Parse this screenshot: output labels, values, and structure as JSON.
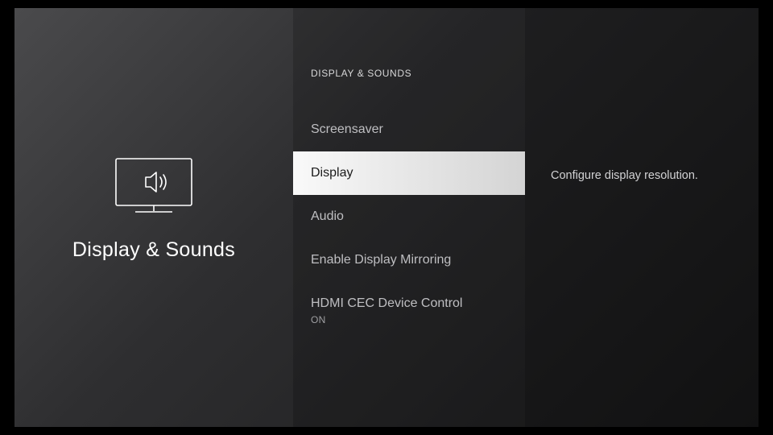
{
  "left": {
    "title": "Display & Sounds"
  },
  "middle": {
    "header": "DISPLAY & SOUNDS",
    "items": [
      {
        "label": "Screensaver",
        "sub": null,
        "selected": false
      },
      {
        "label": "Display",
        "sub": null,
        "selected": true
      },
      {
        "label": "Audio",
        "sub": null,
        "selected": false
      },
      {
        "label": "Enable Display Mirroring",
        "sub": null,
        "selected": false
      },
      {
        "label": "HDMI CEC Device Control",
        "sub": "ON",
        "selected": false
      }
    ]
  },
  "right": {
    "description": "Configure display resolution."
  }
}
